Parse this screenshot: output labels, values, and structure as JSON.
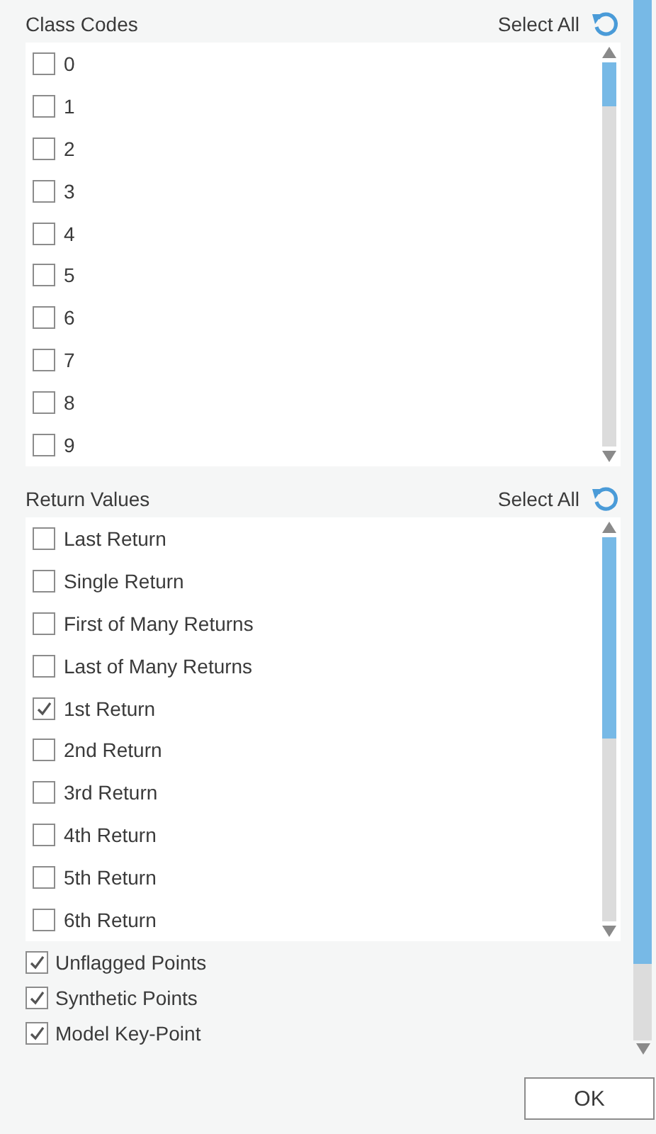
{
  "sections": [
    {
      "title": "Class Codes",
      "select_all": "Select All",
      "items": [
        {
          "label": "0",
          "checked": false
        },
        {
          "label": "1",
          "checked": false
        },
        {
          "label": "2",
          "checked": false
        },
        {
          "label": "3",
          "checked": false
        },
        {
          "label": "4",
          "checked": false
        },
        {
          "label": "5",
          "checked": false
        },
        {
          "label": "6",
          "checked": false
        },
        {
          "label": "7",
          "checked": false
        },
        {
          "label": "8",
          "checked": false
        },
        {
          "label": "9",
          "checked": false
        }
      ]
    },
    {
      "title": "Return Values",
      "select_all": "Select All",
      "items": [
        {
          "label": "Last Return",
          "checked": false
        },
        {
          "label": "Single Return",
          "checked": false
        },
        {
          "label": "First of Many Returns",
          "checked": false
        },
        {
          "label": "Last of Many Returns",
          "checked": false
        },
        {
          "label": "1st Return",
          "checked": true
        },
        {
          "label": "2nd Return",
          "checked": false
        },
        {
          "label": "3rd Return",
          "checked": false
        },
        {
          "label": "4th Return",
          "checked": false
        },
        {
          "label": "5th Return",
          "checked": false
        },
        {
          "label": "6th Return",
          "checked": false
        }
      ]
    }
  ],
  "flags": [
    {
      "label": "Unflagged Points",
      "checked": true
    },
    {
      "label": "Synthetic Points",
      "checked": true
    },
    {
      "label": "Model Key-Point",
      "checked": true
    }
  ],
  "ok_button": "OK"
}
